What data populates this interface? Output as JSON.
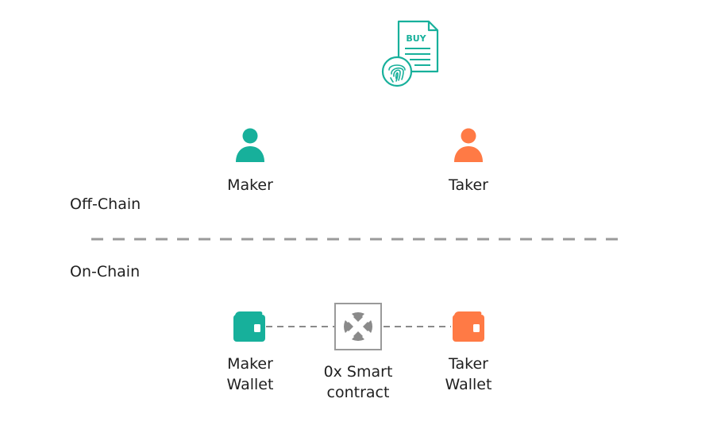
{
  "order_doc": {
    "text": "BUY",
    "icon": "order-document-fingerprint-icon"
  },
  "off_chain": {
    "label": "Off-Chain",
    "maker": {
      "label": "Maker",
      "icon": "person-icon",
      "color": "#17b09b"
    },
    "taker": {
      "label": "Taker",
      "icon": "person-icon",
      "color": "#ff7a45"
    }
  },
  "on_chain": {
    "label": "On-Chain",
    "maker_wallet": {
      "label": "Maker\nWallet",
      "icon": "wallet-icon",
      "color": "#17b09b"
    },
    "contract": {
      "label": "0x Smart\ncontract",
      "icon": "0x-logo-icon",
      "color": "#8a8a8a"
    },
    "taker_wallet": {
      "label": "Taker\nWallet",
      "icon": "wallet-icon",
      "color": "#ff7a45"
    }
  },
  "colors": {
    "accent_teal": "#17b09b",
    "accent_orange": "#ff7a45",
    "divider_gray": "#9a9a9a"
  }
}
